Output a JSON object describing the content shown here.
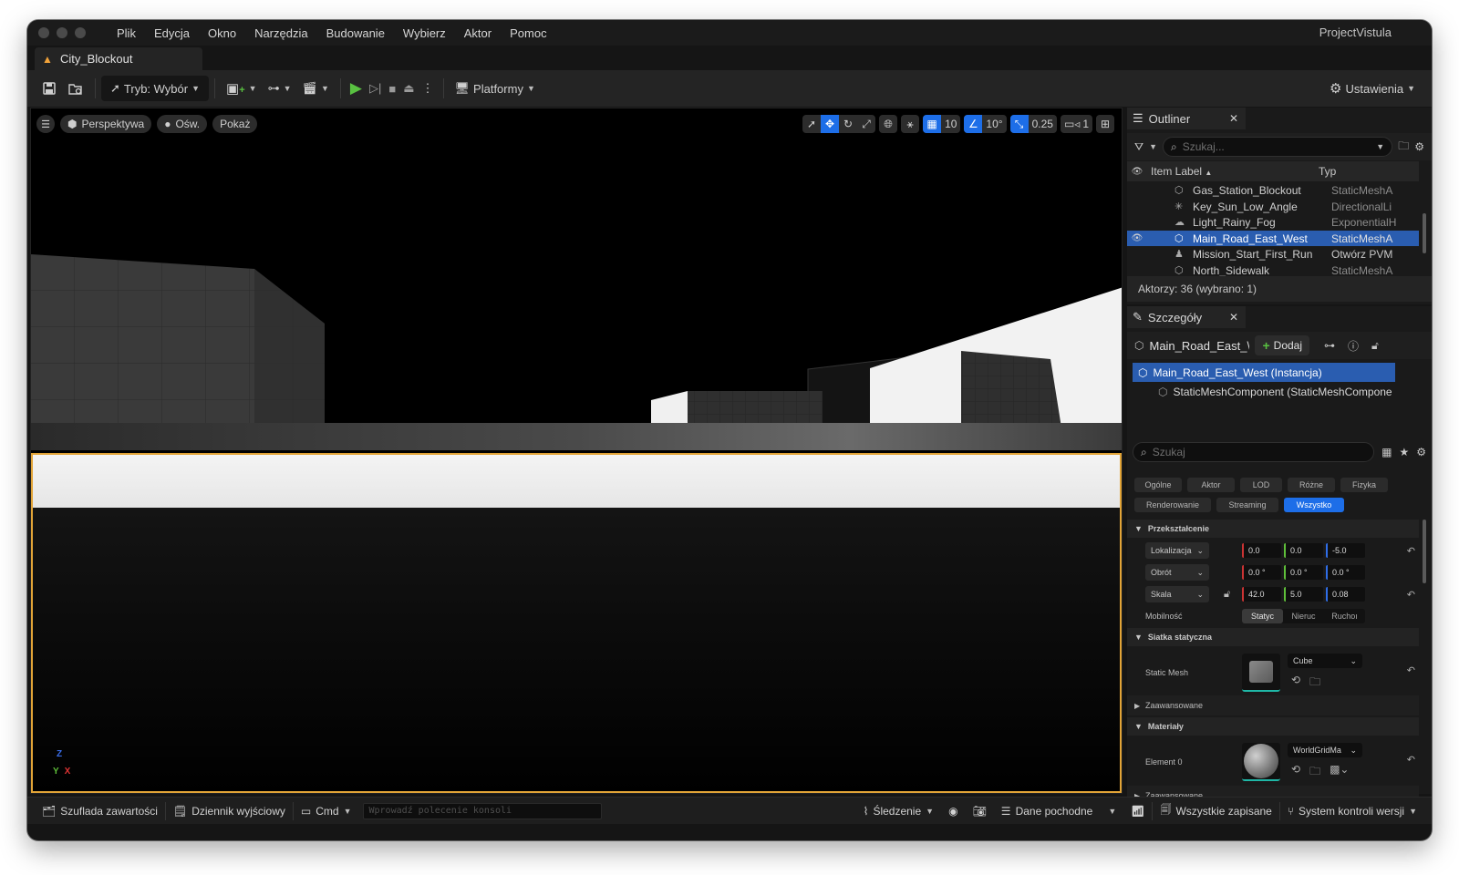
{
  "window": {
    "menu": [
      "Plik",
      "Edycja",
      "Okno",
      "Narzędzia",
      "Budowanie",
      "Wybierz",
      "Aktor",
      "Pomoc"
    ],
    "project": "ProjectVistula",
    "tab": "City_Blockout"
  },
  "toolbar": {
    "mode": "Tryb: Wybór",
    "platforms": "Platformy",
    "settings": "Ustawienia"
  },
  "viewport": {
    "perspective": "Perspektywa",
    "lighting": "Ośw.",
    "show": "Pokaż",
    "grid_snap": "10",
    "rot_snap": "10°",
    "scale_snap": "0.25",
    "camera_speed": "1",
    "axis": {
      "z": "Z",
      "y": "Y",
      "x": "X"
    }
  },
  "outliner": {
    "title": "Outliner",
    "search_placeholder": "Szukaj...",
    "col_label": "Item Label",
    "col_type": "Typ",
    "rows": [
      {
        "label": "Gas_Station_Blockout",
        "type": "StaticMeshA",
        "icon": "static-mesh-icon"
      },
      {
        "label": "Key_Sun_Low_Angle",
        "type": "DirectionalLi",
        "icon": "sun-icon"
      },
      {
        "label": "Light_Rainy_Fog",
        "type": "ExponentialH",
        "icon": "fog-icon"
      },
      {
        "label": "Main_Road_East_West",
        "type": "StaticMeshA",
        "icon": "static-mesh-icon",
        "selected": true
      },
      {
        "label": "Mission_Start_First_Run",
        "type": "Otwórz PVM",
        "icon": "player-start-icon"
      },
      {
        "label": "North_Sidewalk",
        "type": "StaticMeshA",
        "icon": "static-mesh-icon"
      }
    ],
    "footer": "Aktorzy: 36 (wybrano: 1)"
  },
  "details": {
    "title": "Szczegóły",
    "actor_name": "Main_Road_East_\\",
    "add_label": "Dodaj",
    "components": [
      {
        "label": "Main_Road_East_West (Instancja)"
      },
      {
        "label": "StaticMeshComponent (StaticMeshCompone"
      }
    ],
    "search_placeholder": "Szukaj",
    "filters_row1": [
      "Ogólne",
      "Aktor",
      "LOD",
      "Różne",
      "Fizyka"
    ],
    "filters_row2": [
      "Renderowanie",
      "Streaming",
      "Wszystko"
    ],
    "transform": {
      "category": "Przekształcenie",
      "location": {
        "label": "Lokalizacja",
        "x": "0.0",
        "y": "0.0",
        "z": "-5.0"
      },
      "rotation": {
        "label": "Obrót",
        "x": "0.0 °",
        "y": "0.0 °",
        "z": "0.0 °"
      },
      "scale": {
        "label": "Skala",
        "x": "42.0",
        "y": "5.0",
        "z": "0.08"
      },
      "mobility_label": "Mobilność",
      "mobility": [
        "Statyc",
        "Nieruc",
        "Ruchoı"
      ]
    },
    "static_mesh": {
      "category": "Siatka statyczna",
      "label": "Static Mesh",
      "asset": "Cube",
      "advanced": "Zaawansowane"
    },
    "materials": {
      "category": "Materiały",
      "label": "Element 0",
      "asset": "WorldGridMa",
      "advanced": "Zaawansowane"
    }
  },
  "statusbar": {
    "content_drawer": "Szuflada zawartości",
    "output_log": "Dziennik wyjściowy",
    "cmd": "Cmd",
    "console_placeholder": "Wprowadź polecenie konsoli",
    "trace": "Śledzenie",
    "derived_data": "Dane pochodne",
    "all_saved": "Wszystkie zapisane",
    "revision_control": "System kontroli wersji"
  }
}
